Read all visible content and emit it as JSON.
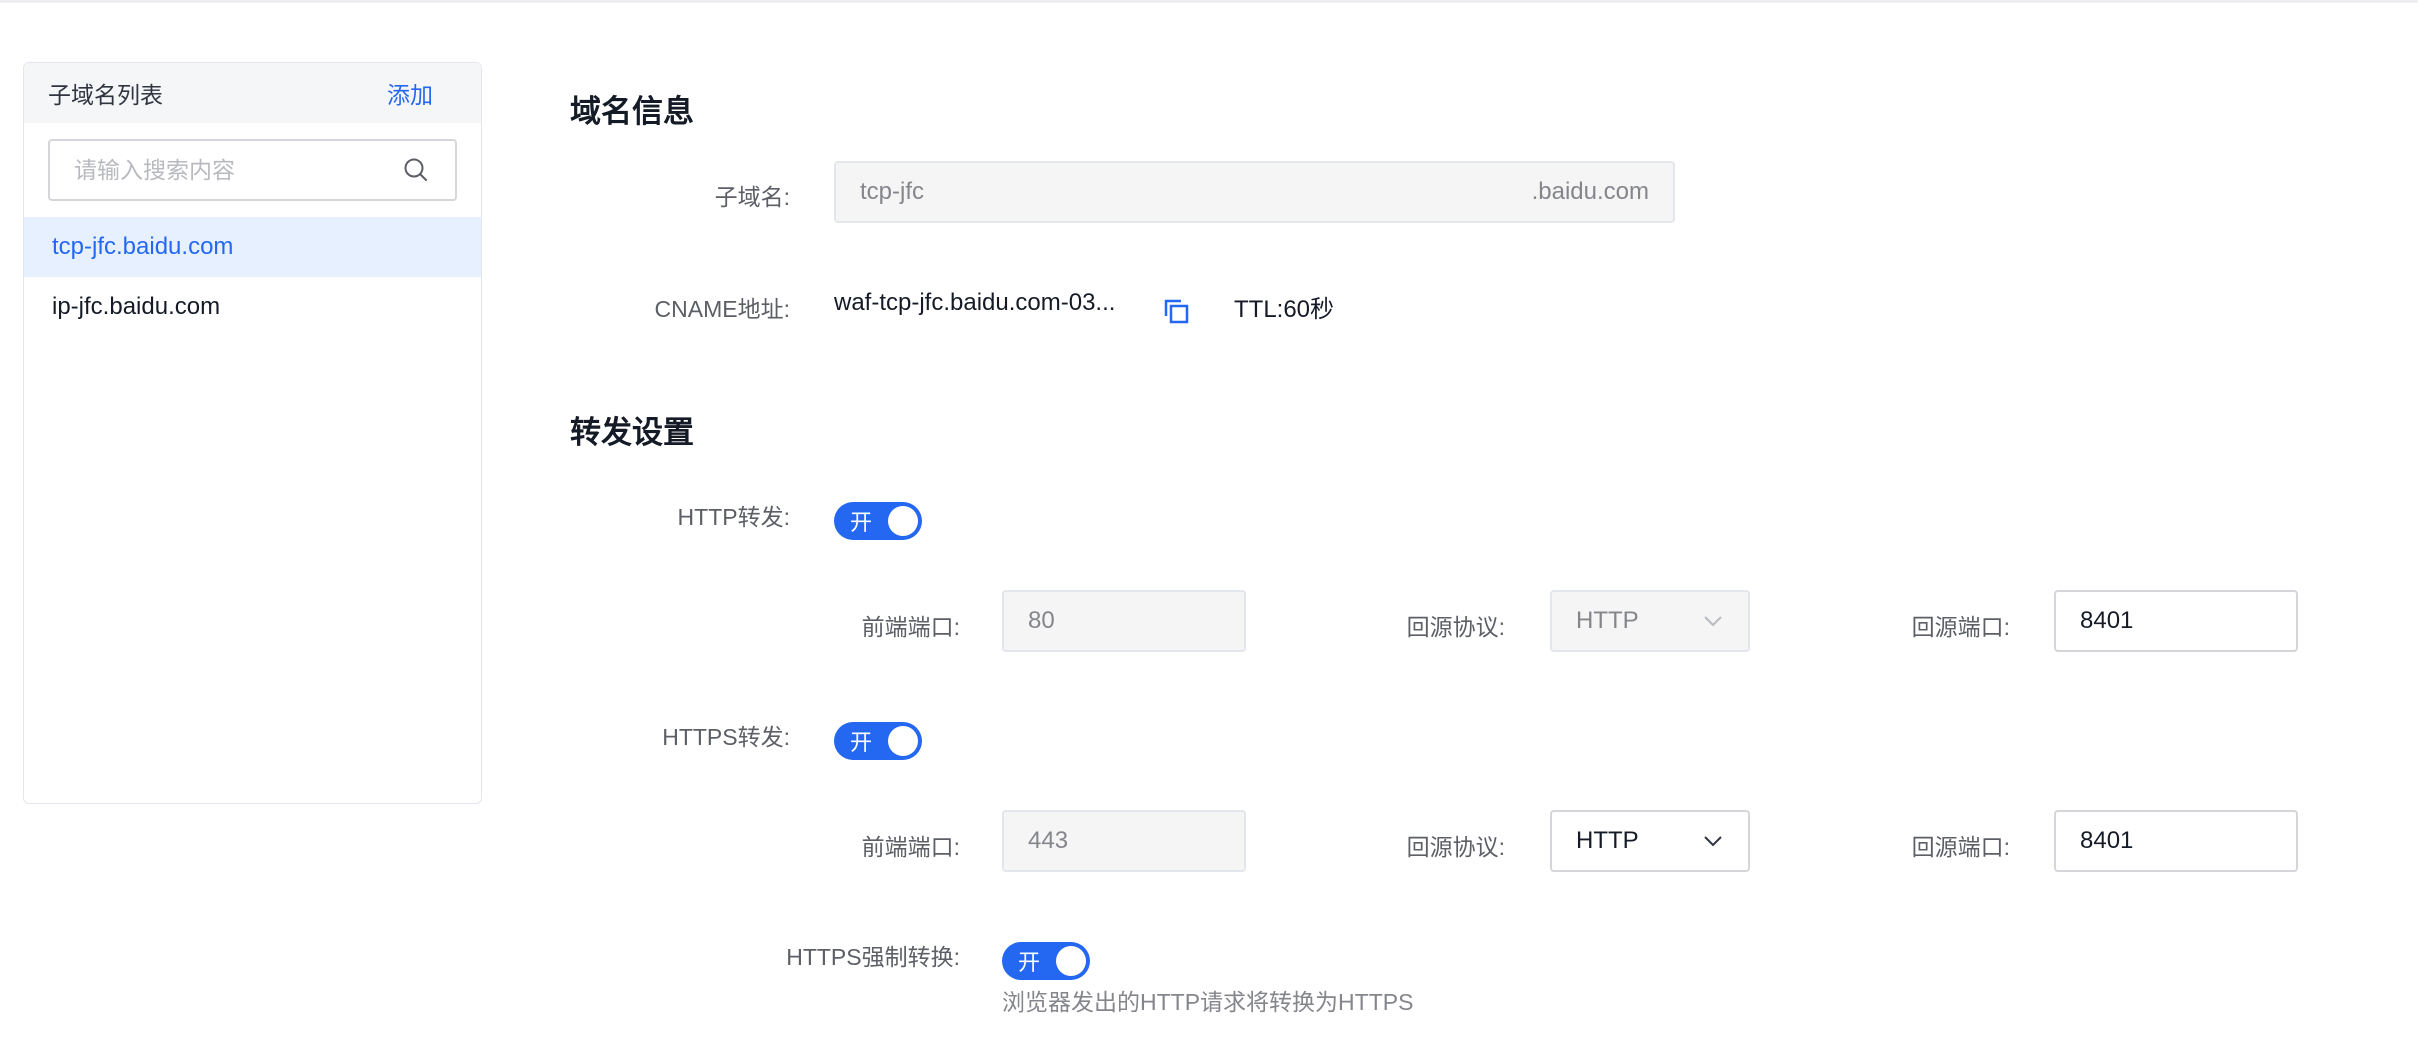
{
  "sidebar": {
    "title": "子域名列表",
    "add_label": "添加",
    "search_placeholder": "请输入搜索内容",
    "items": [
      {
        "label": "tcp-jfc.baidu.com"
      },
      {
        "label": "ip-jfc.baidu.com"
      }
    ]
  },
  "domain_info": {
    "title": "域名信息",
    "subdomain_label": "子域名:",
    "subdomain_value": "tcp-jfc",
    "subdomain_suffix": ".baidu.com",
    "cname_label": "CNAME地址:",
    "cname_value": "waf-tcp-jfc.baidu.com-03...",
    "ttl_text": "TTL:60秒"
  },
  "forwarding": {
    "title": "转发设置",
    "http": {
      "label": "HTTP转发:",
      "switch_text": "开",
      "frontend_port_label": "前端端口:",
      "frontend_port": "80",
      "protocol_label": "回源协议:",
      "protocol": "HTTP",
      "origin_port_label": "回源端口:",
      "origin_port": "8401"
    },
    "https": {
      "label": "HTTPS转发:",
      "switch_text": "开",
      "frontend_port_label": "前端端口:",
      "frontend_port": "443",
      "protocol_label": "回源协议:",
      "protocol": "HTTP",
      "origin_port_label": "回源端口:",
      "origin_port": "8401"
    },
    "force": {
      "label": "HTTPS强制转换:",
      "switch_text": "开",
      "hint": "浏览器发出的HTTP请求将转换为HTTPS"
    }
  },
  "colors": {
    "accent": "#2468f2",
    "active_bg": "#e6f0ff"
  }
}
